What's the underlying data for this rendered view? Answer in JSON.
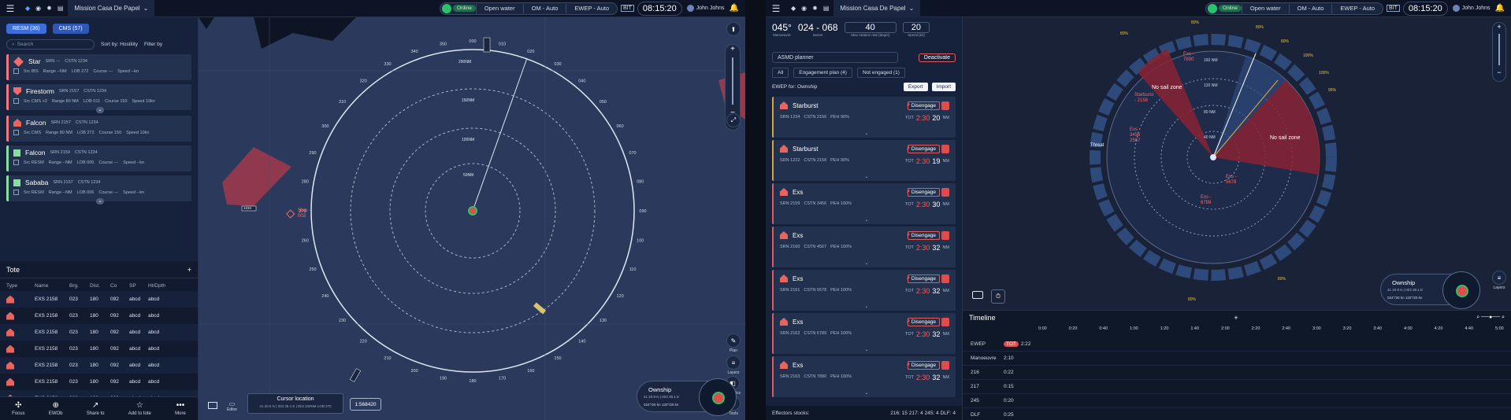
{
  "topbar": {
    "mission": "Mission Casa De Papel",
    "status": "Online",
    "items": [
      "Open water",
      "OM - Auto",
      "EWEP - Auto"
    ],
    "bit": "BIT",
    "clock": "08:15:20",
    "user": "John Johns"
  },
  "left": {
    "chips": [
      "RESM (36)",
      "CMS (57)"
    ],
    "search_placeholder": "Search",
    "sort": "Sort by: Hostility",
    "filter": "Filter by",
    "tracks": [
      {
        "name": "Star",
        "srn": "SRN ---",
        "cstn": "CSTN 1234",
        "src": "Src IBS",
        "range": "Range --NM",
        "lob": "LOB 272",
        "course": "Course ---",
        "speed": "Speed --kn"
      },
      {
        "name": "Firestorm",
        "srn": "SRN 2157",
        "cstn": "CSTN 1234",
        "src": "Src CMS +2",
        "range": "Range 80 NM",
        "lob": "LOB 011",
        "course": "Course 150",
        "speed": "Speed 10kn"
      },
      {
        "name": "Falcon",
        "srn": "SRN 2157",
        "cstn": "CSTN 1234",
        "src": "Src CMS",
        "range": "Range 80 NM",
        "lob": "LOB 272",
        "course": "Course 150",
        "speed": "Speed 10kn"
      },
      {
        "name": "Falcon",
        "srn": "SRN 2159",
        "cstn": "CSTN 1234",
        "src": "Src RESM",
        "range": "Range --NM",
        "lob": "LOB 006",
        "course": "Course ---",
        "speed": "Speed --kn"
      },
      {
        "name": "Sababa",
        "srn": "SRN 2157",
        "cstn": "CSTN 1234",
        "src": "Src RESM",
        "range": "Range --NM",
        "lob": "LOB 006",
        "course": "Course ---",
        "speed": "Speed --kn"
      }
    ],
    "tote_title": "Tote",
    "tote_headers": [
      "Type",
      "Name",
      "Brg.",
      "Dist.",
      "Co",
      "SP",
      "Ht/Dpth"
    ],
    "tote_rows": [
      [
        "EXS 2158",
        "023",
        "180",
        "092",
        "abcd",
        "abcd"
      ],
      [
        "EXS 2158",
        "023",
        "180",
        "092",
        "abcd",
        "abcd"
      ],
      [
        "EXS 2158",
        "023",
        "180",
        "092",
        "abcd",
        "abcd"
      ],
      [
        "EXS 2158",
        "023",
        "180",
        "092",
        "abcd",
        "abcd"
      ],
      [
        "EXS 2158",
        "023",
        "180",
        "092",
        "abcd",
        "abcd"
      ],
      [
        "EXS 2158",
        "023",
        "180",
        "092",
        "abcd",
        "abcd"
      ],
      [
        "EXS 2158",
        "023",
        "180",
        "092",
        "abcd",
        "abcd"
      ]
    ],
    "nav": [
      "Focus",
      "EWOb",
      "Share to",
      "Add to tote",
      "More"
    ]
  },
  "map1": {
    "range_labels": [
      "200NM",
      "150NM",
      "100NM",
      "50NM"
    ],
    "bearings": [
      "000",
      "010",
      "020",
      "030",
      "040",
      "050",
      "060",
      "070",
      "080",
      "090",
      "100",
      "110",
      "120",
      "130",
      "140",
      "150",
      "160",
      "170",
      "180",
      "190",
      "200",
      "210",
      "220",
      "230",
      "240",
      "250",
      "260",
      "270",
      "280",
      "290",
      "300",
      "310",
      "320",
      "330",
      "340",
      "350"
    ],
    "contact": "Ship - 003",
    "track_tag": "1234",
    "cursor_title": "Cursor location",
    "cursor_sub": "41 20.9 N | 003 38.1 E  |  Dist 100NM LOB 270",
    "scale": "1:568420",
    "ownship": "Ownship",
    "ownship_coords": "41 20.9 N | 003 38.1 E",
    "ownship_data": "024°/20 kn  120°/20 kn",
    "side": [
      "Plan",
      "Layers",
      "Graphics",
      "Tools",
      "Editor"
    ]
  },
  "right": {
    "manoeuvre": {
      "value": "045°",
      "label": "Manoeuvre"
    },
    "sector": {
      "value": "024 - 068",
      "label": "Sector"
    },
    "rotation": {
      "value": "40",
      "label": "Max rotation rate [deg/s]"
    },
    "speed": {
      "value": "20",
      "label": "Speed [kn]"
    },
    "planner": "ASMD planner",
    "deactivate": "Deactivate",
    "filters": [
      "All",
      "Engagement plan (4)",
      "Not engaged (1)"
    ],
    "ewep_for": "EWEP for: Ownship",
    "export": "Export",
    "import": "Import",
    "engagements": [
      {
        "name": "Starburst",
        "srn": "SRN 1234",
        "cstn": "CSTN 2156",
        "peh": "PEH 90%",
        "tot": "2:30",
        "dist": "20"
      },
      {
        "name": "Starburst",
        "srn": "SRN 1222",
        "cstn": "CSTN 2158",
        "peh": "PEH 90%",
        "tot": "2:30",
        "dist": "19"
      },
      {
        "name": "Exs",
        "srn": "SRN 2159",
        "cstn": "CSTN 3456",
        "peh": "PEH 100%",
        "tot": "2:30",
        "dist": "30"
      },
      {
        "name": "Exs",
        "srn": "SRN 2160",
        "cstn": "CSTN 4567",
        "peh": "PEH 100%",
        "tot": "2:30",
        "dist": "32"
      },
      {
        "name": "Exs",
        "srn": "SRN 2161",
        "cstn": "CSTN 5678",
        "peh": "PEH 100%",
        "tot": "2:30",
        "dist": "32"
      },
      {
        "name": "Exs",
        "srn": "SRN 2162",
        "cstn": "CSTN 6789",
        "peh": "PEH 100%",
        "tot": "2:30",
        "dist": "32"
      },
      {
        "name": "Exs",
        "srn": "SRN 2163",
        "cstn": "CSTN 7890",
        "peh": "PEH 100%",
        "tot": "2:30",
        "dist": "32"
      }
    ],
    "disengage": "Disengage",
    "tot_label": "TOT",
    "nm": "NM",
    "stocks_label": "Effectors stocks:",
    "stocks": "216: 15   217: 4   245: 4   DLF: 4",
    "map": {
      "no_sail": "No sail zone",
      "threat": "Threat",
      "rings": [
        "160 NM",
        "120 NM",
        "80 NM",
        "40 NM"
      ],
      "pct": [
        "80%",
        "80%",
        "80%",
        "80%",
        "100%",
        "100%",
        "95%",
        "80%",
        "80%"
      ],
      "contacts": [
        "Exs - 7890",
        "Exs - 3456 2567",
        "Exs - 5678",
        "Exs - 6789",
        "Starburst - 2158"
      ]
    },
    "timeline": {
      "title": "Timeline",
      "ticks": [
        "0:00",
        "0:20",
        "0:40",
        "1:00",
        "1:20",
        "1:40",
        "2:00",
        "2:20",
        "2:40",
        "3:00",
        "3:20",
        "3:40",
        "4:00",
        "4:20",
        "4:40",
        "5:00"
      ],
      "rows": [
        {
          "name": "EWEP",
          "value": "2:22",
          "tag": "TOT"
        },
        {
          "name": "Manoeuvre",
          "value": "2:10",
          "tag": ""
        },
        {
          "name": "216",
          "value": "0:22",
          "tag": ""
        },
        {
          "name": "217",
          "value": "0:15",
          "tag": ""
        },
        {
          "name": "245",
          "value": "0:20",
          "tag": ""
        },
        {
          "name": "DLF",
          "value": "0:25",
          "tag": ""
        }
      ]
    },
    "ownship": "Ownship"
  }
}
